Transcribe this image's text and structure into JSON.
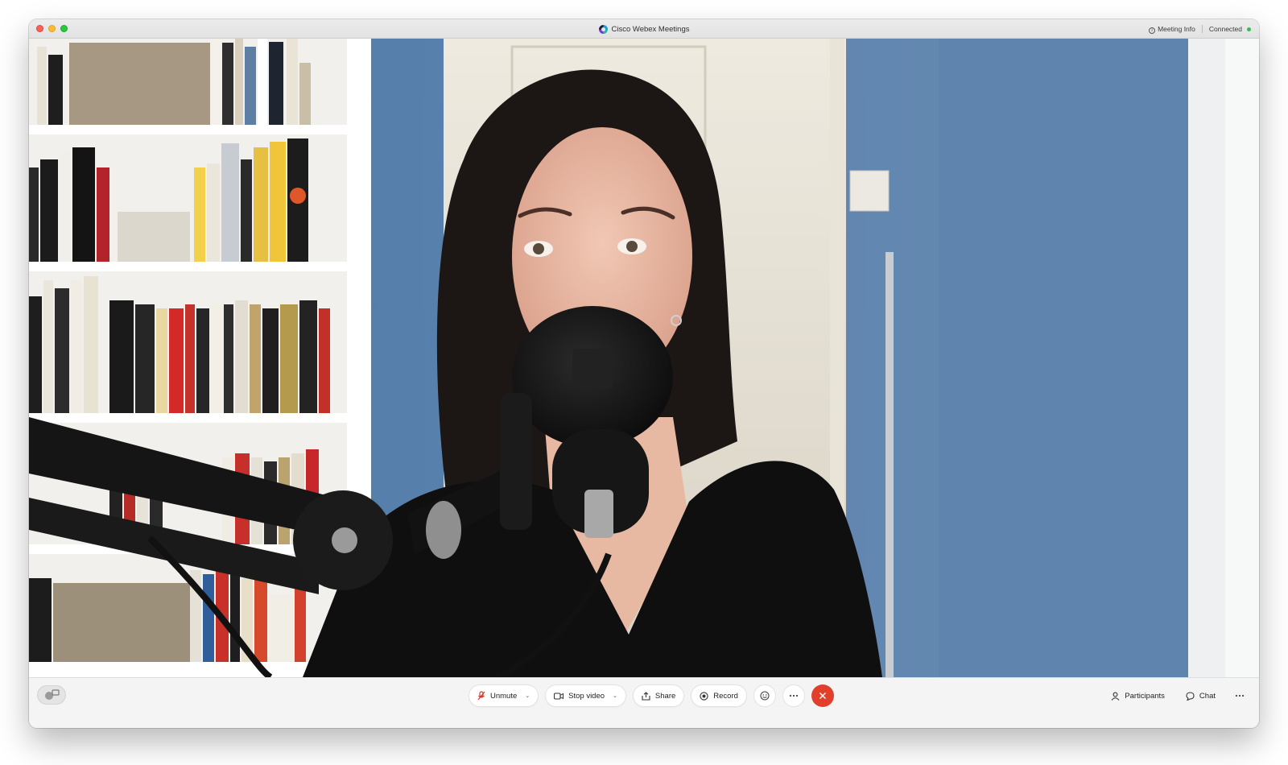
{
  "window": {
    "title": "Cisco Webex Meetings",
    "meeting_info_label": "Meeting Info",
    "connection_status": "Connected"
  },
  "toolbar": {
    "unmute_label": "Unmute",
    "stop_video_label": "Stop video",
    "share_label": "Share",
    "record_label": "Record",
    "participants_label": "Participants",
    "chat_label": "Chat"
  },
  "colors": {
    "end_call": "#e0402b",
    "connected_dot": "#2fbf4a",
    "wall_blue": "#5b7ea6"
  },
  "icons": [
    "webex-logo-icon",
    "info-icon",
    "self-view-icon",
    "microphone-muted-icon",
    "video-camera-icon",
    "share-icon",
    "record-icon",
    "reactions-icon",
    "more-icon",
    "end-call-icon",
    "participants-icon",
    "chat-icon"
  ]
}
